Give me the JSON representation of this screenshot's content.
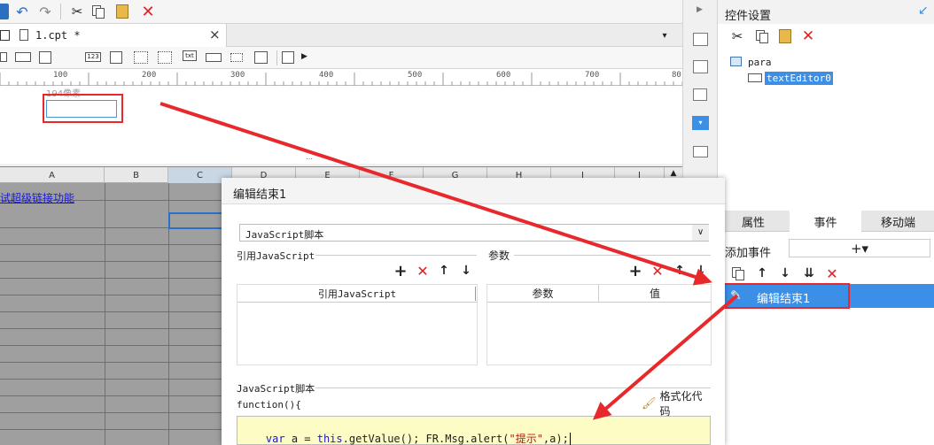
{
  "document_tab": {
    "title": "1.cpt *",
    "close": "×"
  },
  "ruler": {
    "ticks": [
      "100",
      "200",
      "300",
      "400",
      "500",
      "600",
      "700",
      "80"
    ]
  },
  "canvas": {
    "widget_hint": "194像素"
  },
  "sheet": {
    "columns": [
      "A",
      "B",
      "C",
      "D",
      "E",
      "F",
      "G",
      "H",
      "I",
      "J"
    ],
    "cell_a1": "试超级链接功能"
  },
  "right_panel": {
    "title": "控件设置",
    "tree": {
      "root": "para",
      "child": "textEditor0"
    },
    "tabs": [
      "属性",
      "事件",
      "移动端"
    ],
    "add_event_label": "添加事件",
    "add_event_button": "+▾",
    "event_item": "编辑结束1"
  },
  "dialog": {
    "title": "编辑结束1",
    "script_type": "JavaScript脚本",
    "ref_js_section": "引用JavaScript",
    "ref_js_column": "引用JavaScript",
    "params_section": "参数",
    "params_columns": [
      "参数",
      "值"
    ],
    "script_section": "JavaScript脚本",
    "function_header": "function(){",
    "format_code": "格式化代码",
    "code": {
      "kw1": "var",
      "p1": " a = ",
      "kw2": "this",
      "p2": ".getValue(); FR.Msg.alert(",
      "str": "\"提示\"",
      "p3": ",a);"
    }
  },
  "colors": {
    "accent": "#3b8fe6",
    "annotation": "#e8292c",
    "code_bg": "#fdfcc4"
  }
}
